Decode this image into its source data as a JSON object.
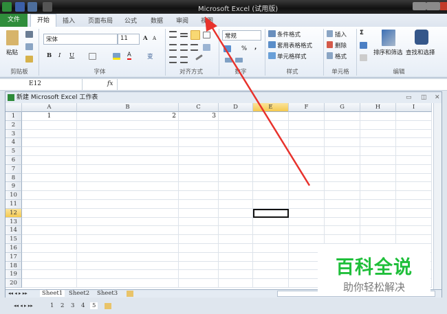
{
  "window": {
    "title": "Microsoft Excel (试用版)"
  },
  "ribbon_tabs": {
    "file": "文件",
    "items": [
      "开始",
      "插入",
      "页面布局",
      "公式",
      "数据",
      "审阅",
      "视图"
    ]
  },
  "clipboard": {
    "paste": "粘贴",
    "group": "剪贴板"
  },
  "font": {
    "name": "宋体",
    "size": "11",
    "bold": "B",
    "italic": "I",
    "underline": "U",
    "grow": "A",
    "shrink": "A",
    "color_btn": "A",
    "phonetic": "变",
    "group": "字体"
  },
  "alignment": {
    "group": "对齐方式"
  },
  "number": {
    "format": "常规",
    "percent": "%",
    "comma": ",",
    "group": "数字"
  },
  "styles": {
    "conditional": "条件格式",
    "table": "套用表格格式",
    "cell": "单元格样式",
    "group": "样式"
  },
  "cells": {
    "insert": "插入",
    "delete": "删除",
    "format": "格式",
    "group": "单元格"
  },
  "editing": {
    "sum": "Σ",
    "sort": "排序和筛选",
    "find": "查找和选择",
    "group": "编辑"
  },
  "formula_bar": {
    "name_box": "E12",
    "fx": "fx",
    "value": ""
  },
  "workbook": {
    "title": "新建 Microsoft Excel 工作表"
  },
  "sheet": {
    "columns": [
      "A",
      "B",
      "C",
      "D",
      "E",
      "F",
      "G",
      "H",
      "I"
    ],
    "rows": [
      "1",
      "2",
      "3",
      "4",
      "5",
      "6",
      "7",
      "8",
      "9",
      "10",
      "11",
      "12",
      "13",
      "14",
      "15",
      "16",
      "17",
      "18",
      "19",
      "20"
    ],
    "cells": {
      "A1": "1",
      "B1": "2",
      "C1": "3"
    },
    "active_cell": "E12"
  },
  "sheet_tabs": [
    "Sheet1",
    "Sheet2",
    "Sheet3"
  ],
  "outer_sheet_tabs": [
    "1",
    "2",
    "3",
    "4",
    "5"
  ],
  "watermark": {
    "title": "百科全说",
    "subtitle": "助你轻松解决"
  },
  "colors": {
    "file_tab": "#2f8d3b",
    "arrow": "#e8322c",
    "watermark": "#1fbf3a",
    "selected_header": "#f4c94f"
  }
}
